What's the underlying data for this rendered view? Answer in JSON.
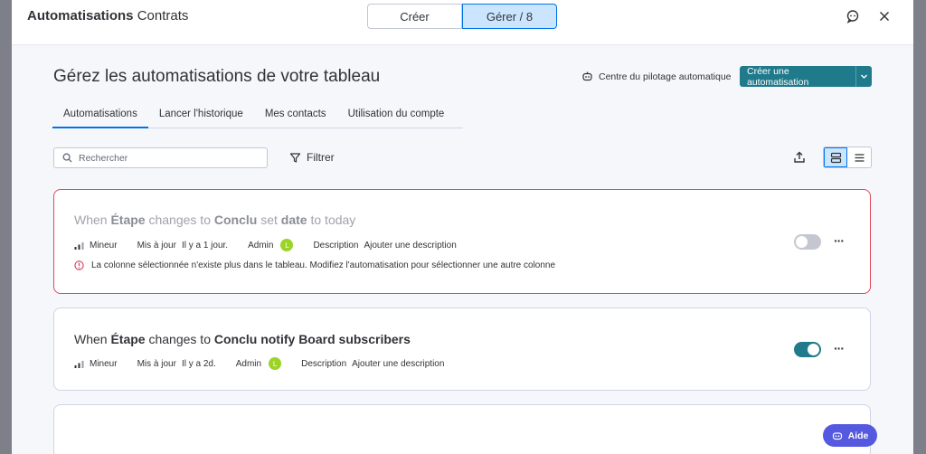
{
  "header": {
    "app_title_bold": "Automatisations",
    "app_title_rest": "Contrats",
    "segments": [
      {
        "label": "Créer",
        "active": false
      },
      {
        "label": "Gérer / 8",
        "active": true
      }
    ]
  },
  "page": {
    "title": "Gérez les automatisations de votre tableau",
    "pilot_label": "Centre du pilotage automatique",
    "create_label": "Créer une automatisation"
  },
  "tabs": [
    {
      "label": "Automatisations",
      "active": true
    },
    {
      "label": "Lancer l'historique",
      "active": false
    },
    {
      "label": "Mes contacts",
      "active": false
    },
    {
      "label": "Utilisation du compte",
      "active": false
    }
  ],
  "toolbar": {
    "search_placeholder": "Rechercher",
    "filter_label": "Filtrer"
  },
  "automations": [
    {
      "title_parts": [
        {
          "text": "When ",
          "strong": false
        },
        {
          "text": "Étape",
          "strong": true
        },
        {
          "text": " changes to ",
          "strong": false
        },
        {
          "text": "Conclu",
          "strong": true
        },
        {
          "text": " set ",
          "strong": false
        },
        {
          "text": "date",
          "strong": true
        },
        {
          "text": " to today",
          "strong": false
        }
      ],
      "level": "Mineur",
      "updated_label": "Mis à jour",
      "updated_value": "Il y a 1 jour.",
      "owner_label": "Admin",
      "avatar_letter": "L",
      "description_label": "Description",
      "description_value": "Ajouter une description",
      "error": "La colonne sélectionnée n'existe plus dans le tableau. Modifiez l'automatisation pour sélectionner une autre colonne",
      "enabled": false
    },
    {
      "title_parts": [
        {
          "text": "When ",
          "strong": false
        },
        {
          "text": "Étape",
          "strong": true
        },
        {
          "text": " changes to ",
          "strong": false
        },
        {
          "text": "Conclu notify Board subscribers",
          "strong": true
        }
      ],
      "level": "Mineur",
      "updated_label": "Mis à jour",
      "updated_value": "Il y a 2d.",
      "owner_label": "Admin",
      "avatar_letter": "L",
      "description_label": "Description",
      "description_value": "Ajouter une description",
      "error": "",
      "enabled": true
    }
  ],
  "help": {
    "label": "Aide"
  },
  "colors": {
    "accent": "#1f7a8c",
    "error": "#e2445c",
    "help": "#5559df",
    "avatar": "#9cd326"
  }
}
